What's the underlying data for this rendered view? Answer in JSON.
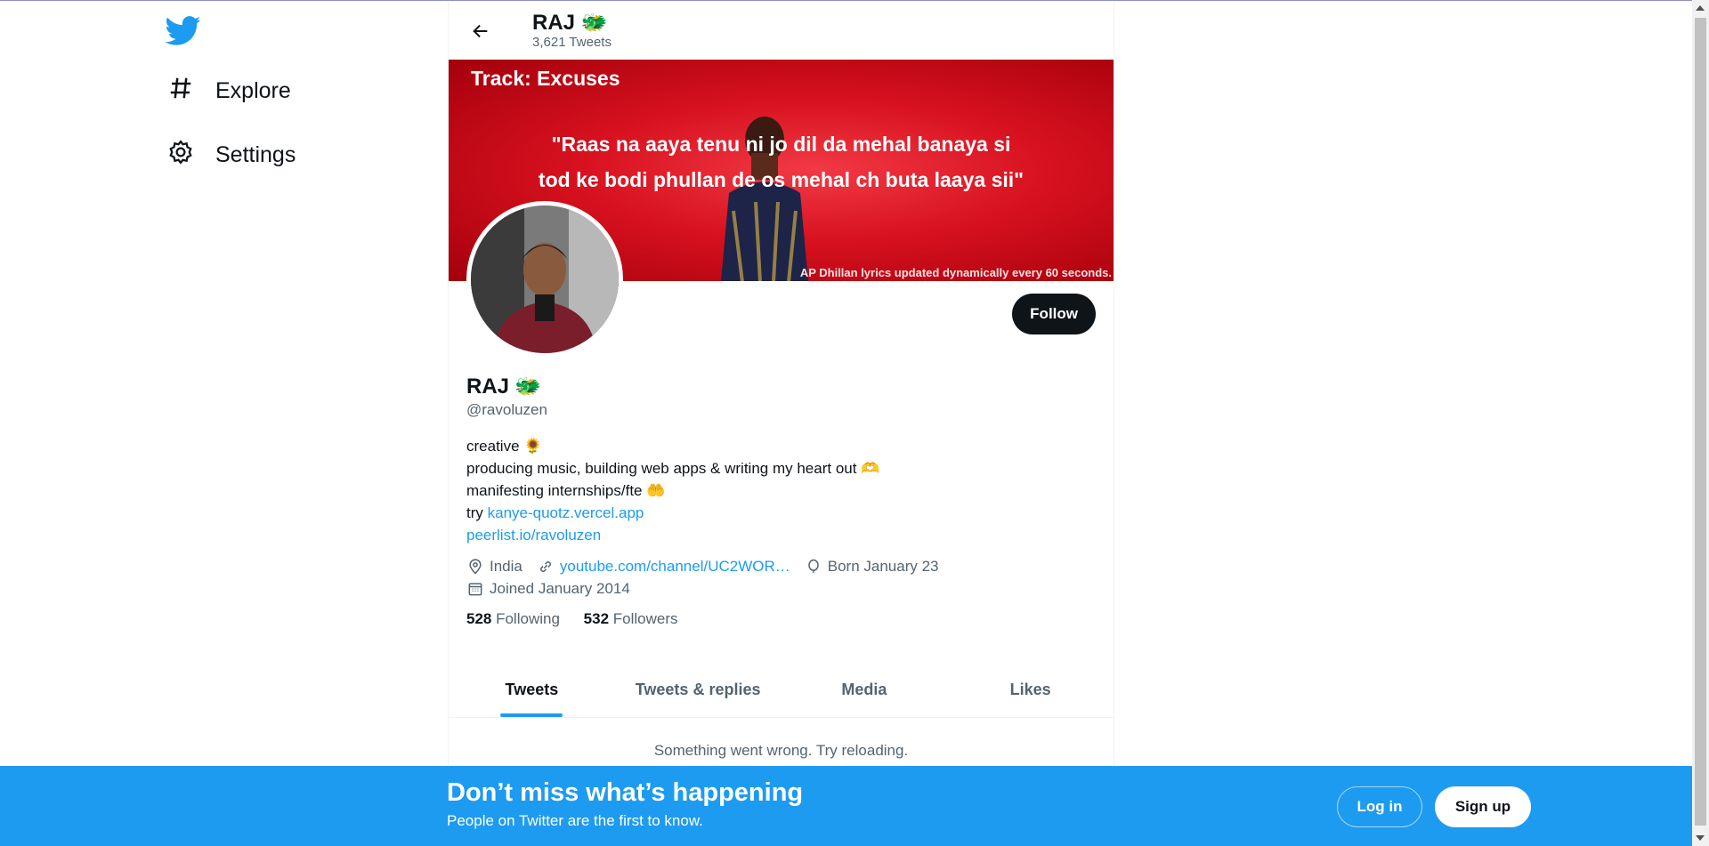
{
  "nav": {
    "explore_label": "Explore",
    "settings_label": "Settings"
  },
  "header": {
    "title": "RAJ 🐲",
    "tweet_count": "3,621 Tweets"
  },
  "banner": {
    "track": "Track: Excuses",
    "lyric_line1": "\"Raas na aaya tenu ni jo dil da mehal banaya si",
    "lyric_line2": "tod ke bodi phullan de os mehal ch buta laaya sii\"",
    "footer": "AP Dhillan lyrics updated dynamically every 60 seconds."
  },
  "profile": {
    "name": "RAJ",
    "name_emoji": "🐲",
    "handle": "@ravoluzen",
    "follow_label": "Follow",
    "bio_line1": "creative 🌻",
    "bio_line2": "producing music, building web apps & writing my heart out 🫶",
    "bio_line3": "manifesting internships/fte 🤲",
    "bio_try": "try ",
    "bio_link1": "kanye-quotz.vercel.app",
    "bio_link2": "peerlist.io/ravoluzen",
    "location": "India",
    "website": "youtube.com/channel/UC2WOR…",
    "birthday": "Born January 23",
    "joined": "Joined January 2014",
    "following_count": "528",
    "following_label": " Following",
    "followers_count": "532",
    "followers_label": " Followers"
  },
  "tabs": [
    {
      "label": "Tweets",
      "active": true
    },
    {
      "label": "Tweets & replies"
    },
    {
      "label": "Media"
    },
    {
      "label": "Likes"
    }
  ],
  "error_message": "Something went wrong. Try reloading.",
  "bottom_bar": {
    "title": "Don’t miss what’s happening",
    "subtitle": "People on Twitter are the first to know.",
    "login_label": "Log in",
    "signup_label": "Sign up"
  },
  "colors": {
    "accent": "#1d9bf0",
    "text": "#0f1419",
    "secondary": "#536471",
    "banner_red": "#d8111f"
  },
  "icons": [
    "twitter-logo-icon",
    "hashtag-icon",
    "gear-icon",
    "back-arrow-icon",
    "location-pin-icon",
    "link-icon",
    "balloon-icon",
    "calendar-icon"
  ]
}
